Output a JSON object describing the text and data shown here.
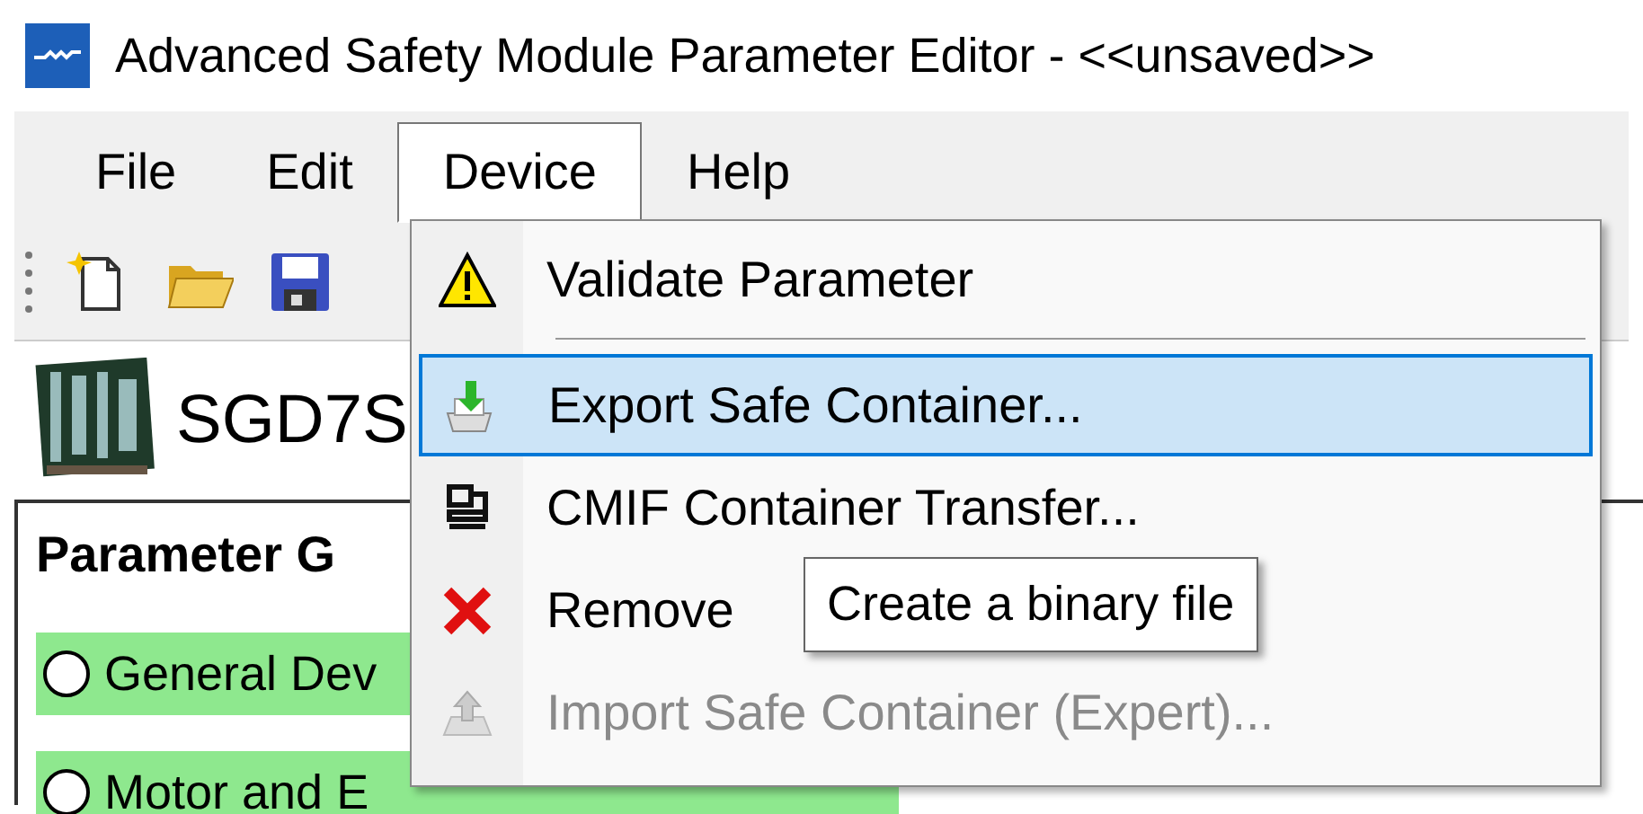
{
  "window": {
    "title": "Advanced Safety Module Parameter Editor - <<unsaved>>"
  },
  "menubar": [
    {
      "label": "File",
      "selected": false
    },
    {
      "label": "Edit",
      "selected": false
    },
    {
      "label": "Device",
      "selected": true
    },
    {
      "label": "Help",
      "selected": false
    }
  ],
  "toolbar": [
    {
      "kind": "new"
    },
    {
      "kind": "open"
    },
    {
      "kind": "save"
    }
  ],
  "device": {
    "name": "SGD7S"
  },
  "panel": {
    "title": "Parameter G",
    "groups": [
      {
        "label": "General Dev",
        "checked": false
      },
      {
        "label": "Motor and E",
        "checked": false
      }
    ]
  },
  "device_menu": [
    {
      "kind": "warning",
      "label": "Validate Parameter",
      "selected": false,
      "disabled": false
    },
    {
      "kind": "separator"
    },
    {
      "kind": "export",
      "label": "Export Safe Container...",
      "selected": true,
      "disabled": false
    },
    {
      "kind": "transfer",
      "label": "CMIF Container Transfer...",
      "selected": false,
      "disabled": false
    },
    {
      "kind": "remove",
      "label": "Remove",
      "selected": false,
      "disabled": false
    },
    {
      "kind": "import",
      "label": "Import Safe Container (Expert)...",
      "selected": false,
      "disabled": true
    }
  ],
  "tooltip": {
    "text": "Create a binary file"
  }
}
